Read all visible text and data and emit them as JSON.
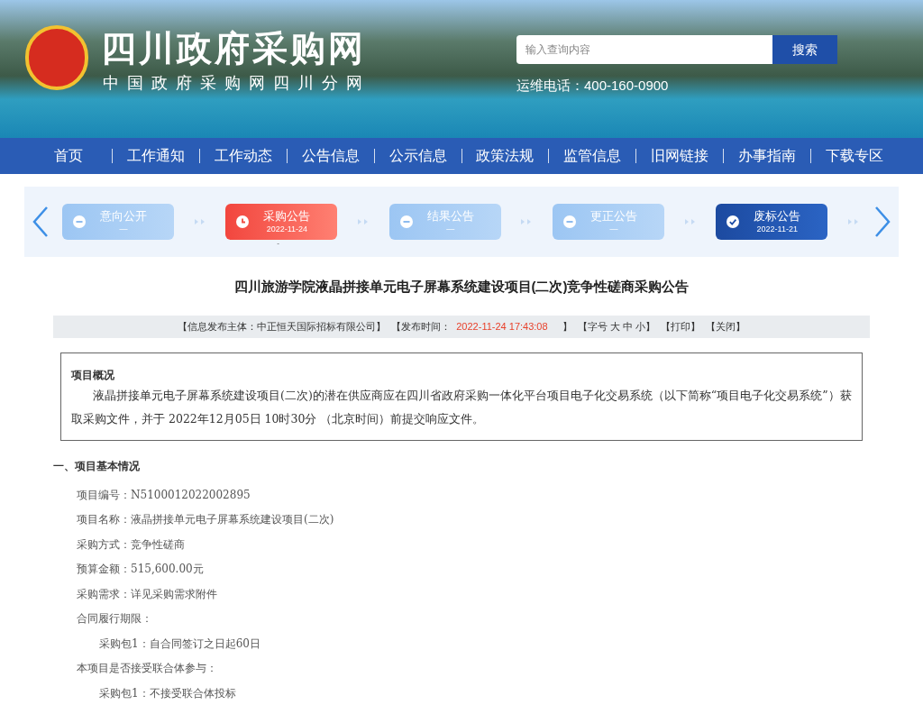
{
  "header": {
    "site_title": "四川政府采购网",
    "site_subtitle": "中国政府采购网四川分网",
    "search": {
      "placeholder": "输入查询内容",
      "button": "搜索"
    },
    "hotline": "运维电话：400-160-0900"
  },
  "nav": [
    "首页",
    "工作通知",
    "工作动态",
    "公告信息",
    "公示信息",
    "政策法规",
    "监管信息",
    "旧网链接",
    "办事指南",
    "下载专区"
  ],
  "steps": [
    {
      "label": "意向公开",
      "sub": "—",
      "kind": "pending"
    },
    {
      "label": "采购公告",
      "sub": "2022-11-24",
      "kind": "current",
      "marker": "-"
    },
    {
      "label": "结果公告",
      "sub": "—",
      "kind": "pending"
    },
    {
      "label": "更正公告",
      "sub": "—",
      "kind": "pending"
    },
    {
      "label": "废标公告",
      "sub": "2022-11-21",
      "kind": "done"
    }
  ],
  "article": {
    "title": "四川旅游学院液晶拼接单元电子屏幕系统建设项目(二次)竞争性磋商采购公告",
    "info_bar": [
      {
        "text": "【信息发布主体：中正恒天国际招标有限公司】",
        "kind": "plain"
      },
      {
        "text": "【发布时间：",
        "kind": "plain"
      },
      {
        "text": "2022-11-24 17:43:08",
        "kind": "highlight"
      },
      {
        "text": "】",
        "kind": "plain"
      },
      {
        "text": "【字号 大 中 小】",
        "kind": "plain"
      },
      {
        "text": "【打印】",
        "kind": "plain"
      },
      {
        "text": "【关闭】",
        "kind": "plain"
      }
    ],
    "overview": {
      "heading": "项目概况",
      "text": "液晶拼接单元电子屏幕系统建设项目(二次)的潜在供应商应在四川省政府采购一体化平台项目电子化交易系统（以下简称“项目电子化交易系统”）获取采购文件，并于 2022年12月05日 10时30分 （北京时间）前提交响应文件。"
    },
    "section_heading": "一、项目基本情况",
    "lines": [
      {
        "text": "项目编号：N5100012022002895"
      },
      {
        "text": "项目名称：液晶拼接单元电子屏幕系统建设项目(二次)"
      },
      {
        "text": "采购方式：竞争性磋商"
      },
      {
        "text": "预算金额：515,600.00元"
      },
      {
        "text": "采购需求：详见采购需求附件"
      },
      {
        "text": "合同履行期限：",
        "children": [
          {
            "text": "采购包1：自合同签订之日起60日"
          }
        ]
      },
      {
        "text": "本项目是否接受联合体参与：",
        "children": [
          {
            "text": "采购包1：不接受联合体投标"
          }
        ]
      }
    ]
  }
}
